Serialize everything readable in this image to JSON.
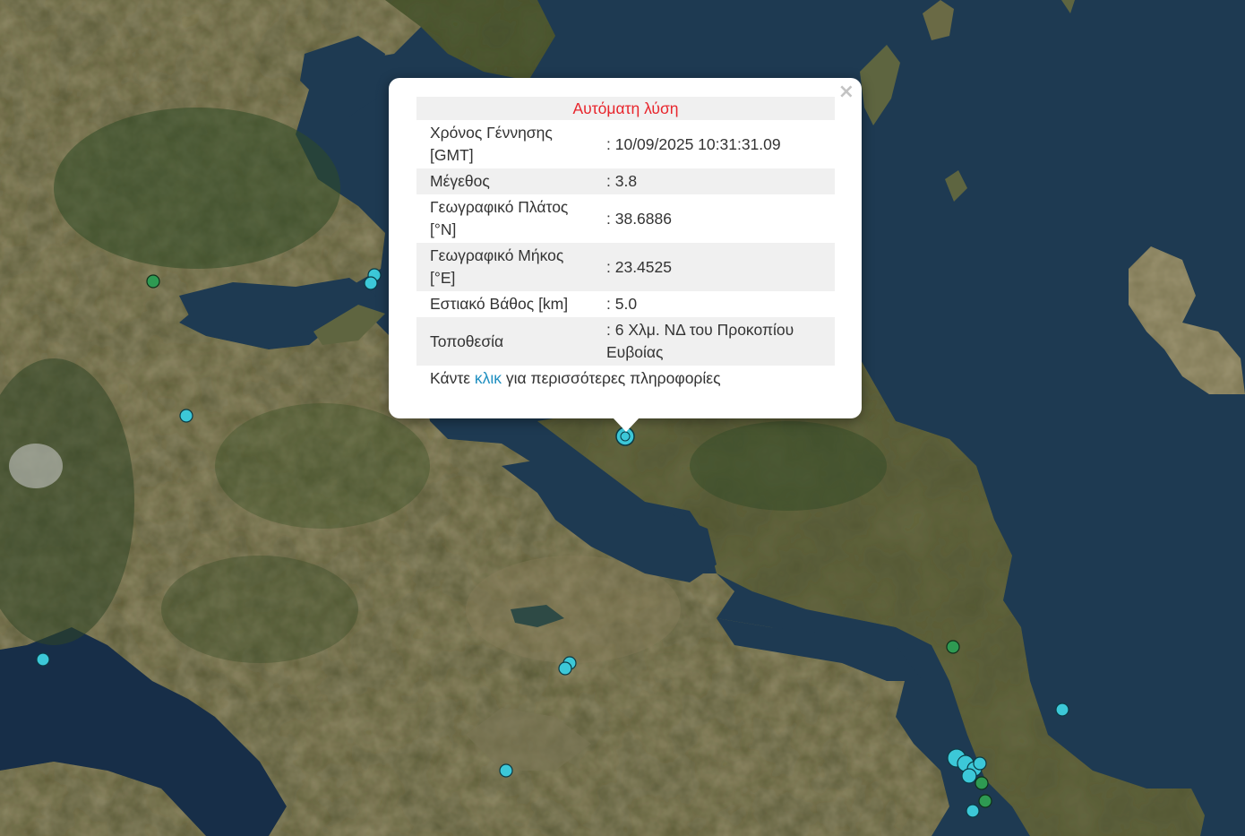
{
  "map": {
    "colors": {
      "sea": "#1d3a52",
      "land": "#5a5a3a",
      "marker_cyan": "#3cc8d8",
      "marker_green": "#2e9a52"
    }
  },
  "popup": {
    "title": "Αυτόματη λύση",
    "rows": [
      {
        "label": "Χρόνος Γέννησης [GMT]",
        "value": ": 10/09/2025 10:31:31.09"
      },
      {
        "label": "Μέγεθος",
        "value": ": 3.8"
      },
      {
        "label": "Γεωγραφικό Πλάτος [°N]",
        "value": ": 38.6886"
      },
      {
        "label": "Γεωγραφικό Μήκος [°E]",
        "value": ": 23.4525"
      },
      {
        "label": "Εστιακό Βάθος [km]",
        "value": ": 5.0"
      },
      {
        "label": "Τοποθεσία",
        "value": ": 6 Χλμ. ΝΔ του Προκοπίου Ευβοίας"
      }
    ],
    "footer": {
      "before": "Κάντε ",
      "link": "κλικ",
      "after": " για περισσότερες πληροφορίες"
    },
    "close": "×"
  }
}
